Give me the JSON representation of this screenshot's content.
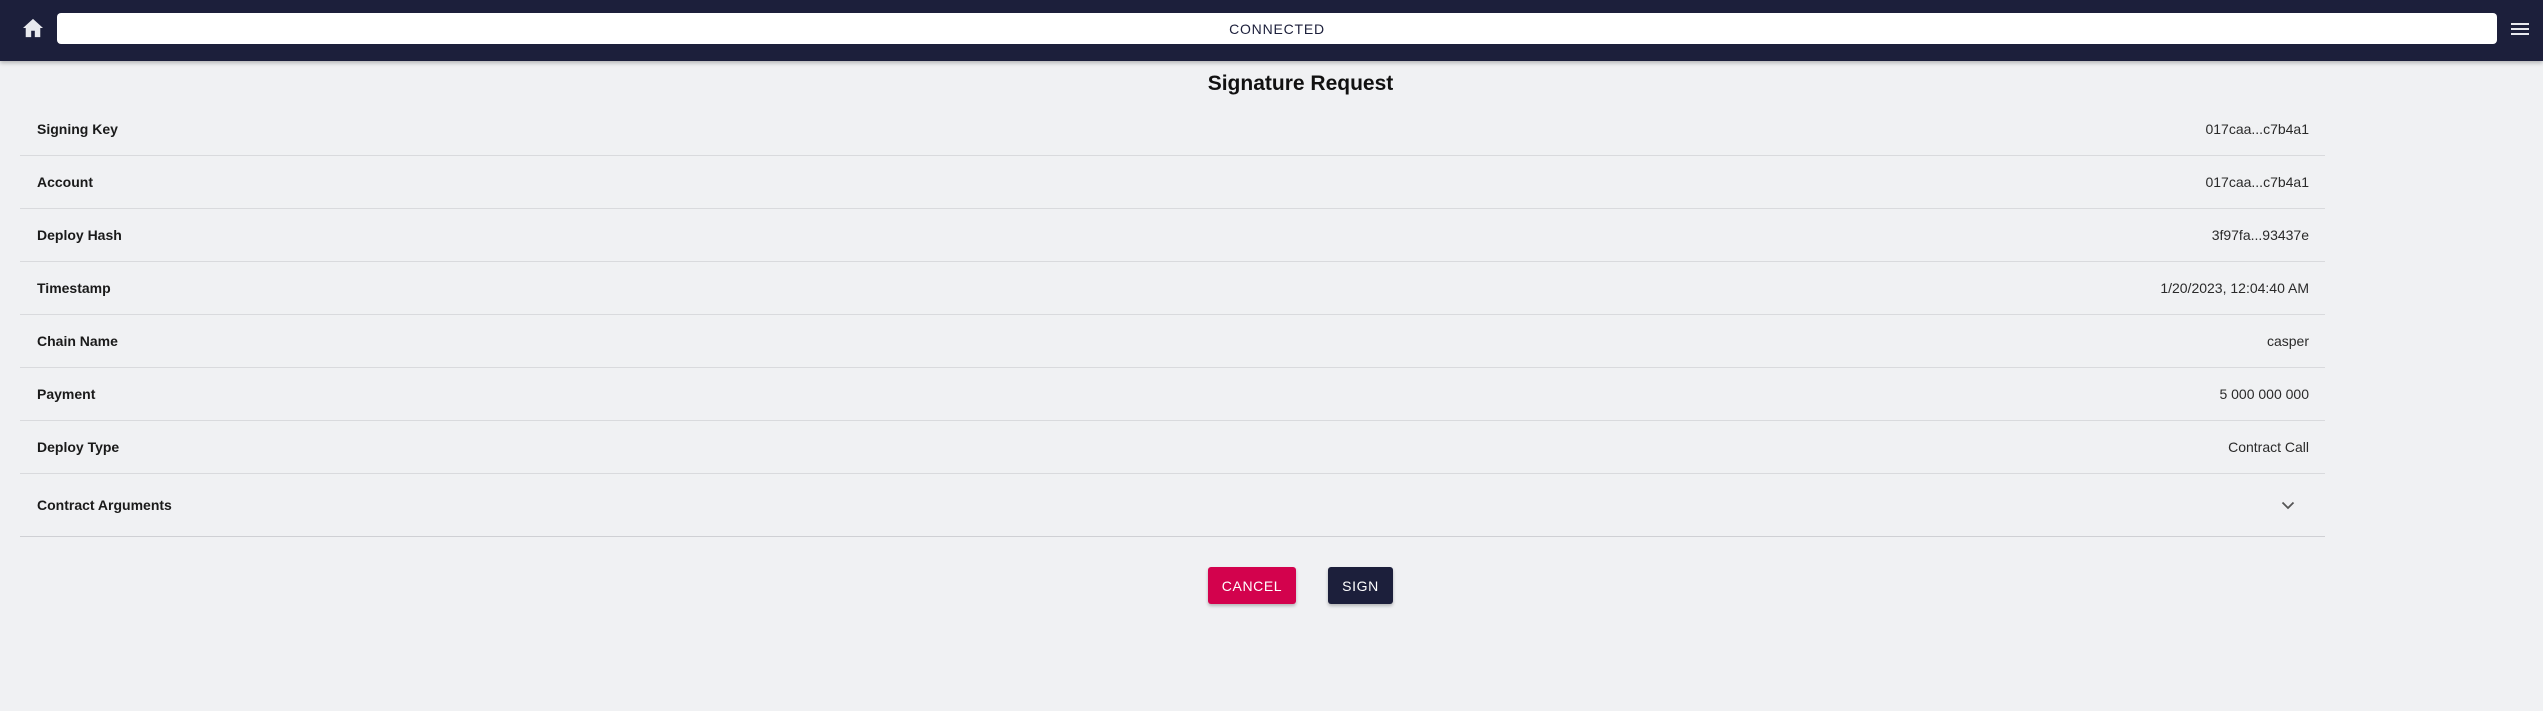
{
  "header": {
    "home_icon": "home-icon",
    "status": "CONNECTED",
    "menu_icon": "hamburger-menu-icon"
  },
  "page_title": "Signature Request",
  "details": [
    {
      "label": "Signing Key",
      "value": "017caa...c7b4a1"
    },
    {
      "label": "Account",
      "value": "017caa...c7b4a1"
    },
    {
      "label": "Deploy Hash",
      "value": "3f97fa...93437e"
    },
    {
      "label": "Timestamp",
      "value": "1/20/2023, 12:04:40 AM"
    },
    {
      "label": "Chain Name",
      "value": "casper"
    },
    {
      "label": "Payment",
      "value": "5 000 000 000"
    },
    {
      "label": "Deploy Type",
      "value": "Contract Call"
    }
  ],
  "contract_arguments": {
    "label": "Contract Arguments",
    "icon": "chevron-down-icon"
  },
  "actions": {
    "cancel_label": "CANCEL",
    "sign_label": "SIGN"
  },
  "colors": {
    "header_bg": "#1c1f3b",
    "cancel": "#d3024d",
    "sign": "#1c1f3b",
    "page_bg": "#f0f1f3"
  }
}
